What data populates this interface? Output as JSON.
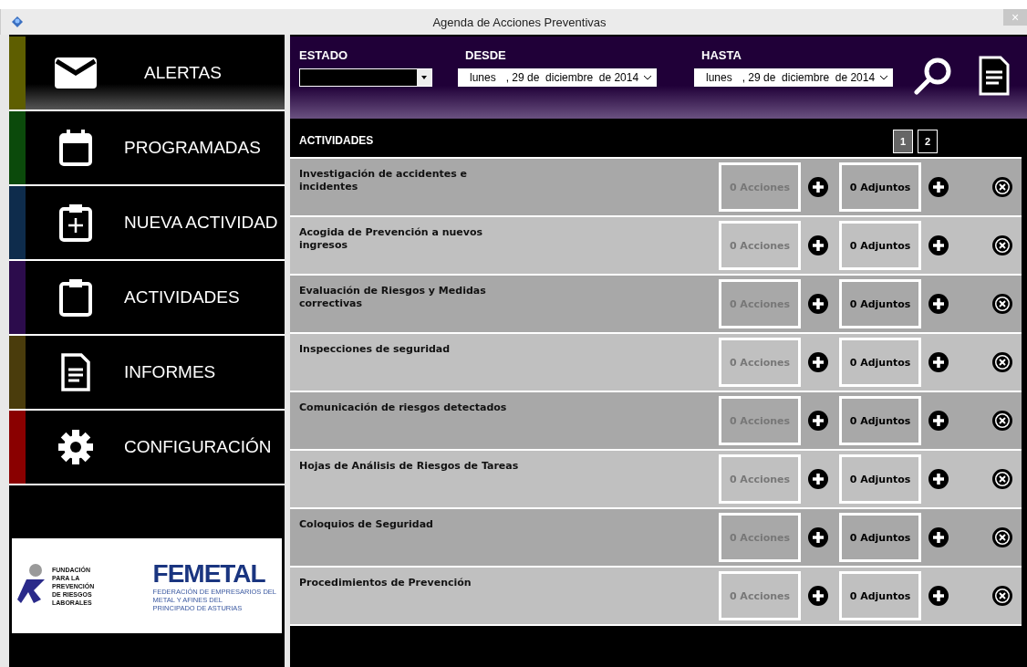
{
  "window": {
    "title": "Agenda de Acciones Preventivas",
    "close": "×"
  },
  "sidebar": {
    "items": [
      {
        "label": "ALERTAS",
        "kind": "envelope",
        "color": "#5e5e00",
        "selected": true
      },
      {
        "label": "PROGRAMADAS",
        "kind": "calendar",
        "color": "#0b4a0b",
        "selected": false
      },
      {
        "label": "NUEVA ACTIVIDAD",
        "kind": "new",
        "color": "#0e2c4c",
        "selected": false
      },
      {
        "label": "ACTIVIDADES",
        "kind": "clipboard",
        "color": "#2c0c4c",
        "selected": false
      },
      {
        "label": "INFORMES",
        "kind": "document",
        "color": "#4a3c0c",
        "selected": false
      },
      {
        "label": "CONFIGURACIÓN",
        "kind": "gear",
        "color": "#8a0000",
        "selected": false
      }
    ],
    "logos": {
      "fundacion": [
        "FUNDACIÓN",
        "PARA LA",
        "PREVENCIÓN",
        "DE RIESGOS",
        "LABORALES"
      ],
      "femetal": "FEMETAL",
      "femetal_sub": [
        "FEDERACIÓN DE EMPRESARIOS DEL",
        "METAL Y AFINES DEL",
        "PRINCIPADO DE ASTURIAS"
      ]
    }
  },
  "filters": {
    "estado": {
      "label": "ESTADO"
    },
    "desde": {
      "label": "DESDE",
      "weekday": "lunes",
      "date": ", 29 de  diciembre  de 2014"
    },
    "hasta": {
      "label": "HASTA",
      "weekday": "lunes",
      "date": ", 29 de  diciembre  de 2014"
    }
  },
  "activities": {
    "title": "ACTIVIDADES",
    "pages": [
      {
        "label": "1",
        "selected": true
      },
      {
        "label": "2",
        "selected": false
      }
    ],
    "rows": [
      {
        "name": "Investigación de accidentes e\nincidentes",
        "acciones": "0 Acciones",
        "adjuntos": "0 Adjuntos"
      },
      {
        "name": "Acogida de Prevención a nuevos\ningresos",
        "acciones": "0 Acciones",
        "adjuntos": "0 Adjuntos"
      },
      {
        "name": "Evaluación de Riesgos y Medidas\ncorrectivas",
        "acciones": "0 Acciones",
        "adjuntos": "0 Adjuntos"
      },
      {
        "name": "Inspecciones de seguridad",
        "acciones": "0 Acciones",
        "adjuntos": "0 Adjuntos"
      },
      {
        "name": "Comunicación de riesgos detectados",
        "acciones": "0 Acciones",
        "adjuntos": "0 Adjuntos"
      },
      {
        "name": "Hojas de Análisis de Riesgos de Tareas",
        "acciones": "0 Acciones",
        "adjuntos": "0 Adjuntos"
      },
      {
        "name": "Coloquios de Seguridad",
        "acciones": "0 Acciones",
        "adjuntos": "0 Adjuntos"
      },
      {
        "name": "Procedimientos de Prevención",
        "acciones": "0 Acciones",
        "adjuntos": "0 Adjuntos"
      }
    ]
  }
}
